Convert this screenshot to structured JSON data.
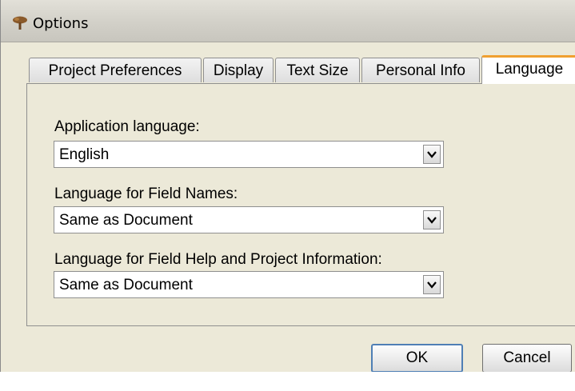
{
  "window": {
    "title": "Options",
    "icon": "tree-icon",
    "colors": {
      "chrome": "#ece9d8",
      "active_tab_accent": "#f0a030",
      "ok_focus": "#4f7fb5"
    }
  },
  "tabs": [
    {
      "label": "Project Preferences",
      "active": false
    },
    {
      "label": "Display",
      "active": false
    },
    {
      "label": "Text Size",
      "active": false
    },
    {
      "label": "Personal Info",
      "active": false
    },
    {
      "label": "Language",
      "active": true
    }
  ],
  "fields": {
    "app_language": {
      "label": "Application language:",
      "value": "English"
    },
    "field_names": {
      "label": "Language for Field Names:",
      "value": "Same as Document"
    },
    "field_help": {
      "label": "Language for Field Help and Project Information:",
      "value": "Same as Document"
    }
  },
  "buttons": {
    "ok": "OK",
    "cancel": "Cancel"
  }
}
